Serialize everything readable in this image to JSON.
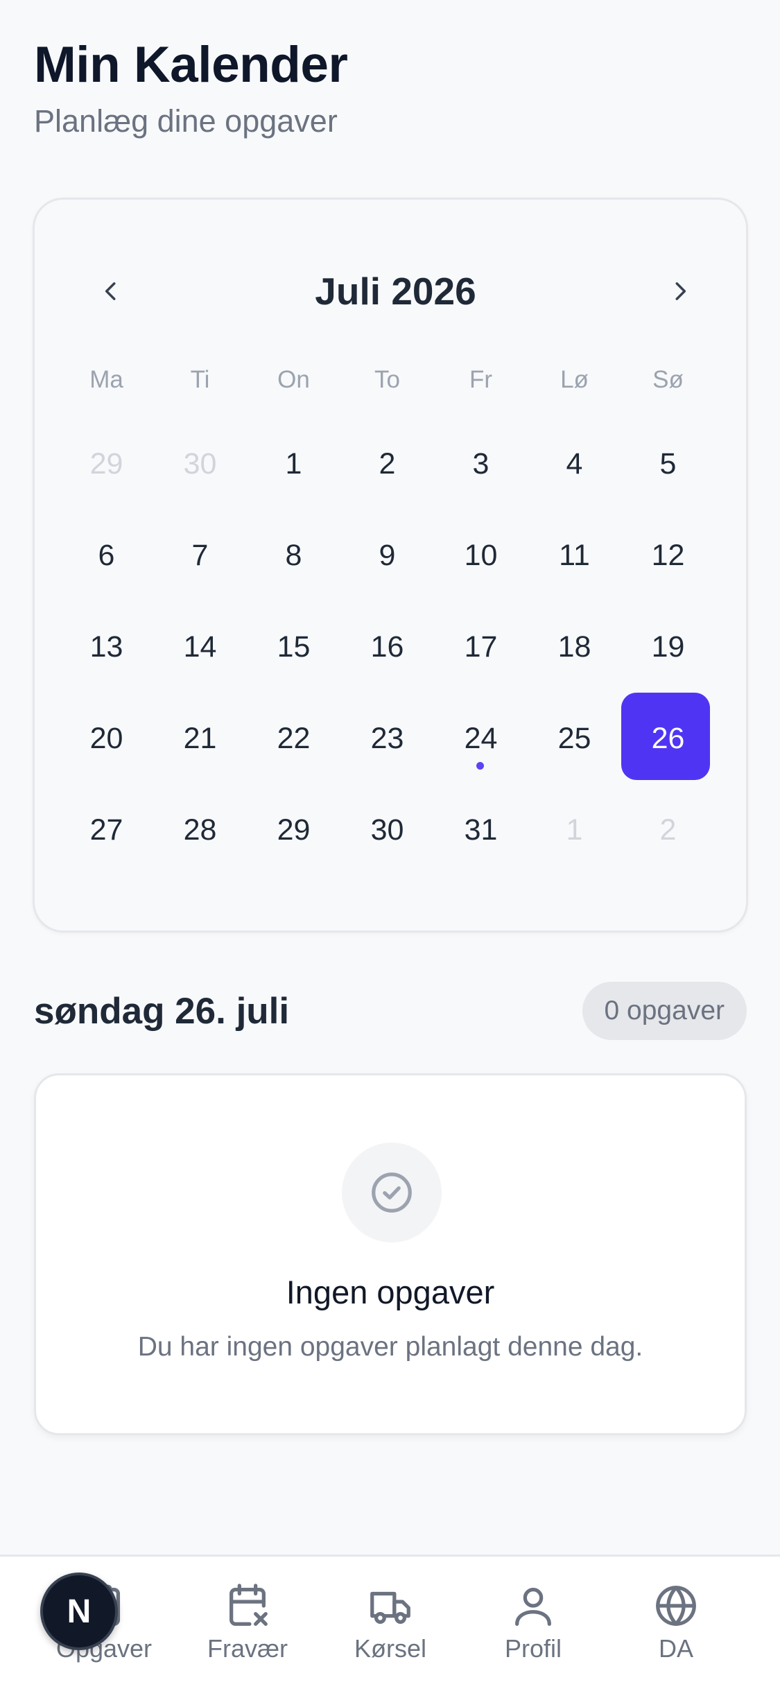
{
  "header": {
    "title": "Min Kalender",
    "subtitle": "Planlæg dine opgaver"
  },
  "calendar": {
    "month_label": "Juli 2026",
    "weekdays": [
      "Ma",
      "Ti",
      "On",
      "To",
      "Fr",
      "Lø",
      "Sø"
    ],
    "days": [
      {
        "n": "29",
        "muted": true
      },
      {
        "n": "30",
        "muted": true
      },
      {
        "n": "1"
      },
      {
        "n": "2"
      },
      {
        "n": "3"
      },
      {
        "n": "4"
      },
      {
        "n": "5"
      },
      {
        "n": "6"
      },
      {
        "n": "7"
      },
      {
        "n": "8"
      },
      {
        "n": "9"
      },
      {
        "n": "10"
      },
      {
        "n": "11"
      },
      {
        "n": "12"
      },
      {
        "n": "13"
      },
      {
        "n": "14"
      },
      {
        "n": "15"
      },
      {
        "n": "16"
      },
      {
        "n": "17"
      },
      {
        "n": "18"
      },
      {
        "n": "19"
      },
      {
        "n": "20"
      },
      {
        "n": "21"
      },
      {
        "n": "22"
      },
      {
        "n": "23"
      },
      {
        "n": "24",
        "dot": true
      },
      {
        "n": "25"
      },
      {
        "n": "26",
        "selected": true
      },
      {
        "n": "27"
      },
      {
        "n": "28"
      },
      {
        "n": "29"
      },
      {
        "n": "30"
      },
      {
        "n": "31"
      },
      {
        "n": "1",
        "muted": true
      },
      {
        "n": "2",
        "muted": true
      }
    ],
    "accent_color": "#4f35f3"
  },
  "selected_day": {
    "title": "søndag 26. juli",
    "count_badge": "0 opgaver"
  },
  "empty_state": {
    "icon": "check-circle-icon",
    "title": "Ingen opgaver",
    "text": "Du har ingen opgaver planlagt denne dag."
  },
  "bottom_nav": {
    "items": [
      {
        "label": "Opgaver",
        "icon": "clipboard-icon"
      },
      {
        "label": "Fravær",
        "icon": "calendar-x-icon"
      },
      {
        "label": "Kørsel",
        "icon": "truck-icon"
      },
      {
        "label": "Profil",
        "icon": "user-icon"
      },
      {
        "label": "DA",
        "icon": "globe-icon"
      }
    ]
  },
  "fab": {
    "label": "N"
  }
}
